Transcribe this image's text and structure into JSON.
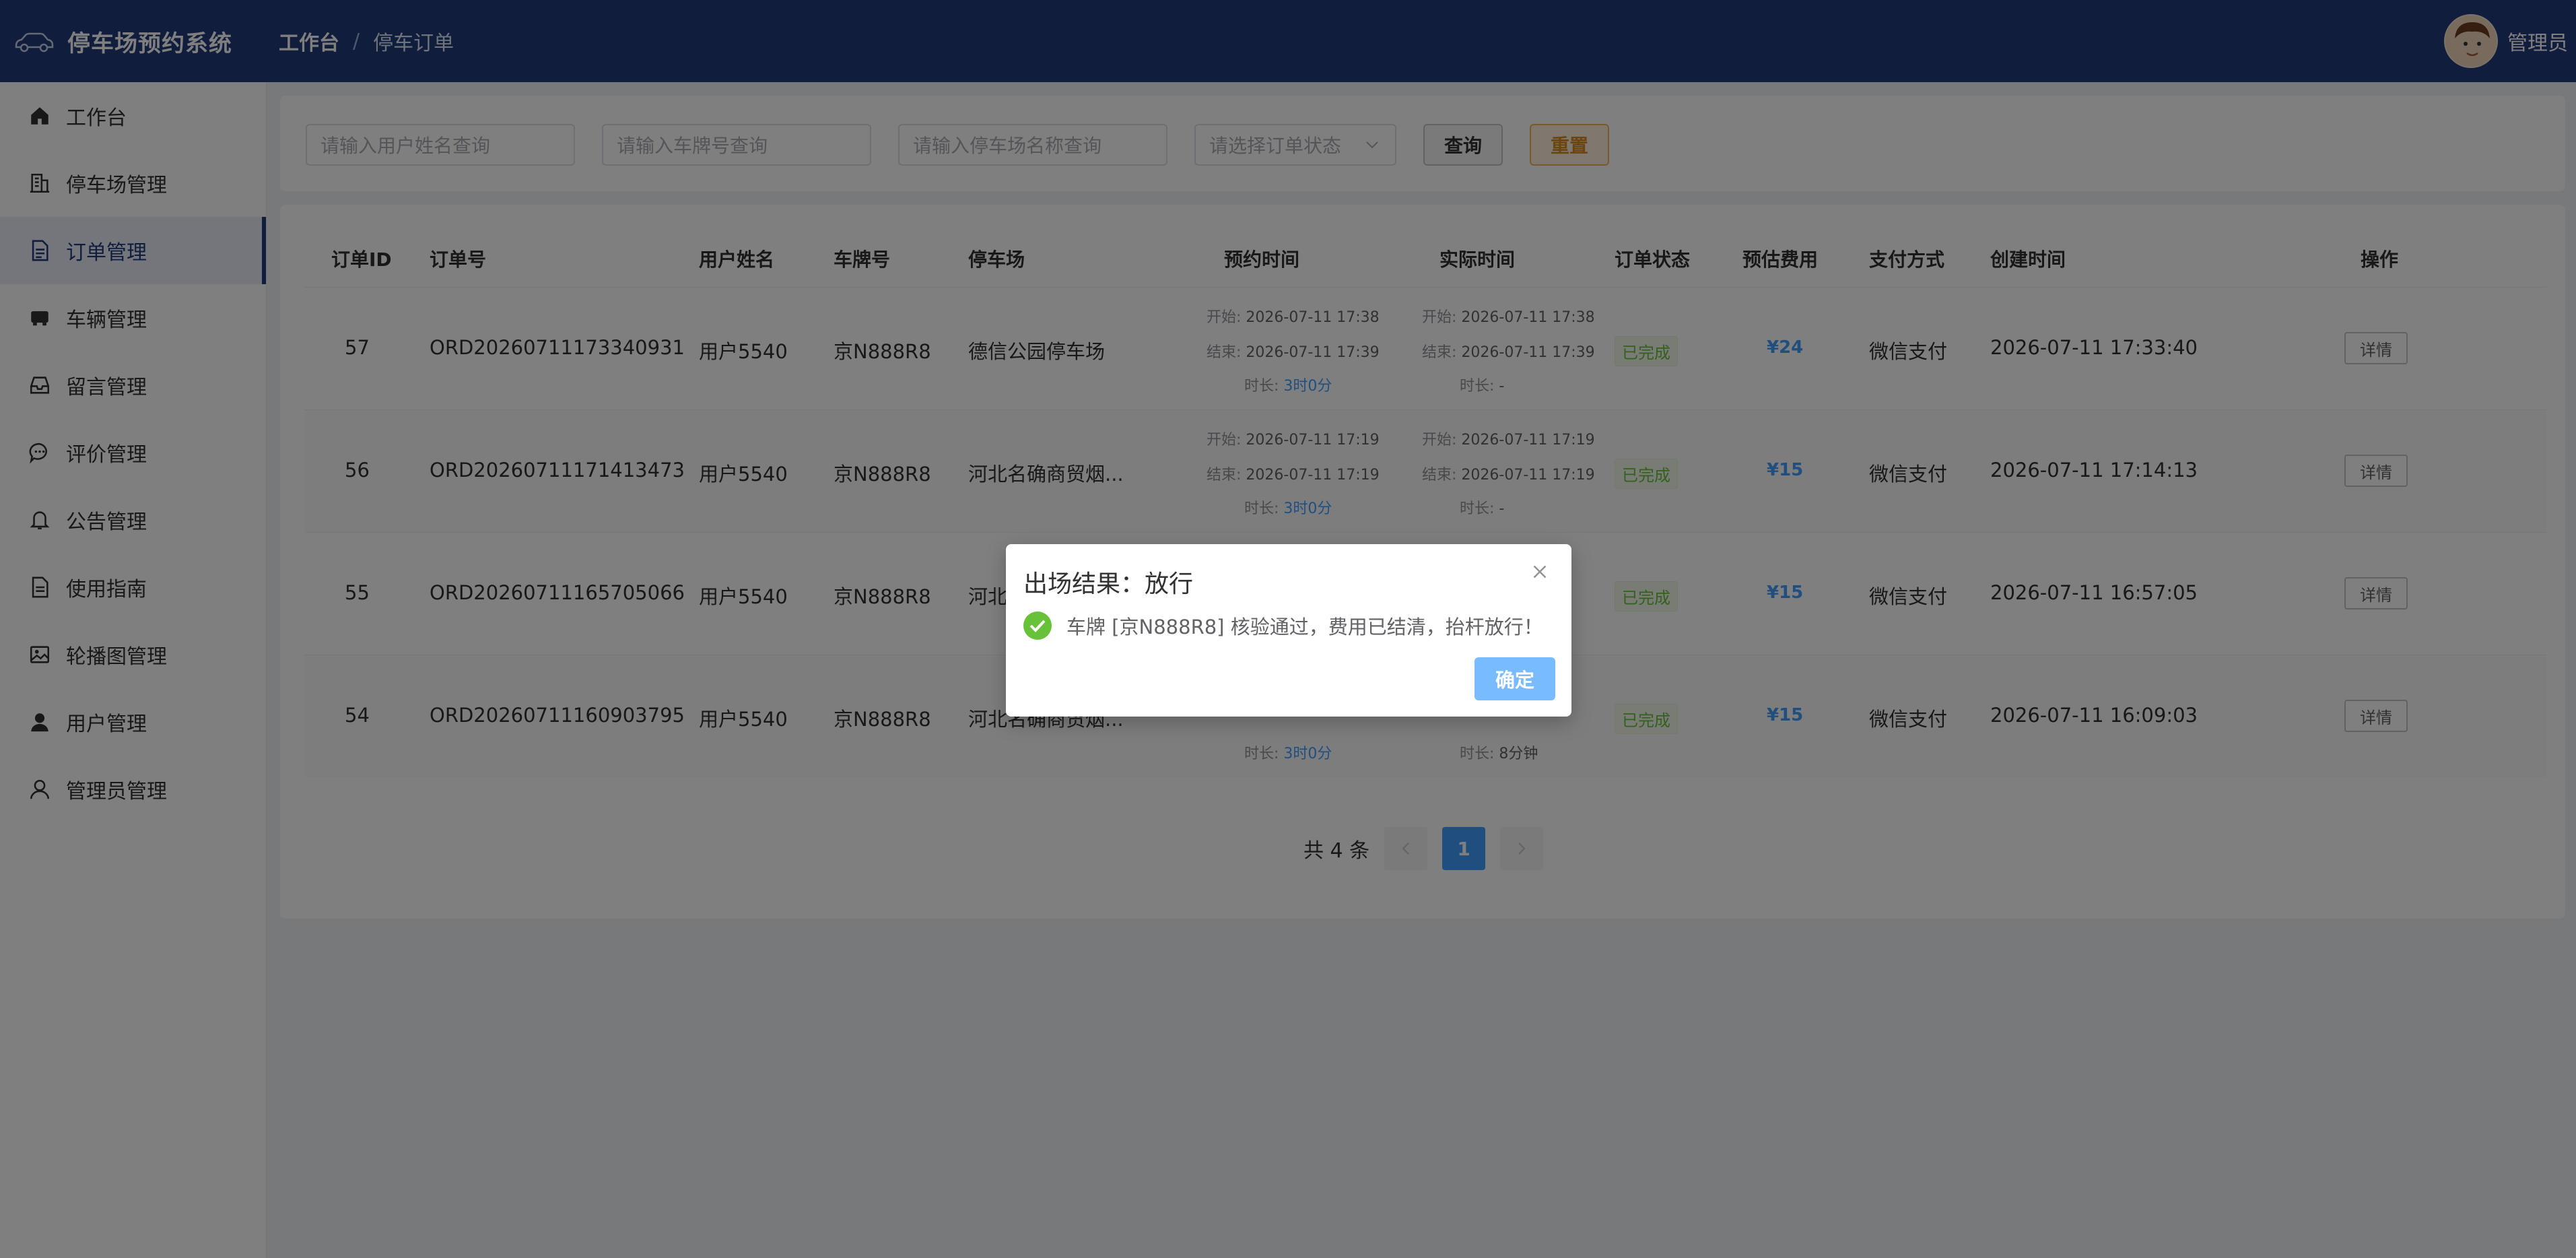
{
  "header": {
    "title": "停车场预约系统",
    "breadcrumb": [
      "工作台",
      "停车订单"
    ],
    "user_name": "管理员"
  },
  "sidebar": {
    "items": [
      {
        "label": "工作台",
        "icon": "home-icon"
      },
      {
        "label": "停车场管理",
        "icon": "building-icon"
      },
      {
        "label": "订单管理",
        "icon": "document-icon"
      },
      {
        "label": "车辆管理",
        "icon": "car-icon"
      },
      {
        "label": "留言管理",
        "icon": "inbox-icon"
      },
      {
        "label": "评价管理",
        "icon": "chat-icon"
      },
      {
        "label": "公告管理",
        "icon": "bell-icon"
      },
      {
        "label": "使用指南",
        "icon": "guide-icon"
      },
      {
        "label": "轮播图管理",
        "icon": "image-icon"
      },
      {
        "label": "用户管理",
        "icon": "user-icon"
      },
      {
        "label": "管理员管理",
        "icon": "admin-icon"
      }
    ],
    "active_index": 2
  },
  "filters": {
    "user_placeholder": "请输入用户姓名查询",
    "plate_placeholder": "请输入车牌号查询",
    "lot_placeholder": "请输入停车场名称查询",
    "status_placeholder": "请选择订单状态",
    "query_label": "查询",
    "reset_label": "重置"
  },
  "table": {
    "headers": [
      "订单ID",
      "订单号",
      "用户姓名",
      "车牌号",
      "停车场",
      "预约时间",
      "实际时间",
      "订单状态",
      "预估费用",
      "支付方式",
      "创建时间",
      "操作"
    ],
    "labels": {
      "start": "开始:",
      "end": "结束:",
      "duration": "时长:"
    },
    "detail_label": "详情",
    "rows": [
      {
        "id": "57",
        "order_no": "ORD20260711173340931",
        "user": "用户5540",
        "plate": "京N888R8",
        "lot": "德信公园停车场",
        "res_start": "2026-07-11 17:38",
        "res_end": "2026-07-11 17:39",
        "res_duration": "3时0分",
        "act_start": "2026-07-11 17:38",
        "act_end": "2026-07-11 17:39",
        "act_duration": "-",
        "status": "已完成",
        "fee": "¥24",
        "pay": "微信支付",
        "created": "2026-07-11 17:33:40"
      },
      {
        "id": "56",
        "order_no": "ORD20260711171413473",
        "user": "用户5540",
        "plate": "京N888R8",
        "lot": "河北名确商贸烟...",
        "res_start": "2026-07-11 17:19",
        "res_end": "2026-07-11 17:19",
        "res_duration": "3时0分",
        "act_start": "2026-07-11 17:19",
        "act_end": "2026-07-11 17:19",
        "act_duration": "-",
        "status": "已完成",
        "fee": "¥15",
        "pay": "微信支付",
        "created": "2026-07-11 17:14:13"
      },
      {
        "id": "55",
        "order_no": "ORD20260711165705066",
        "user": "用户5540",
        "plate": "京N888R8",
        "lot": "河北",
        "status": "已完成",
        "fee": "¥15",
        "pay": "微信支付",
        "created": "2026-07-11 16:57:05"
      },
      {
        "id": "54",
        "order_no": "ORD20260711160903795",
        "user": "用户5540",
        "plate": "京N888R8",
        "lot": "河北名确商贸烟...",
        "res_duration": "3时0分",
        "act_duration": "8分钟",
        "status": "已完成",
        "fee": "¥15",
        "pay": "微信支付",
        "created": "2026-07-11 16:09:03"
      }
    ]
  },
  "pagination": {
    "total_text": "共 4 条",
    "current_page": "1"
  },
  "dialog": {
    "title": "出场结果：放行",
    "message": "车牌 [京N888R8] 核验通过，费用已结清，抬杆放行！",
    "confirm_label": "确定"
  },
  "colors": {
    "header_bg": "#213a7a",
    "accent": "#409eff",
    "success": "#67c23a",
    "warning": "#d68a1b"
  }
}
